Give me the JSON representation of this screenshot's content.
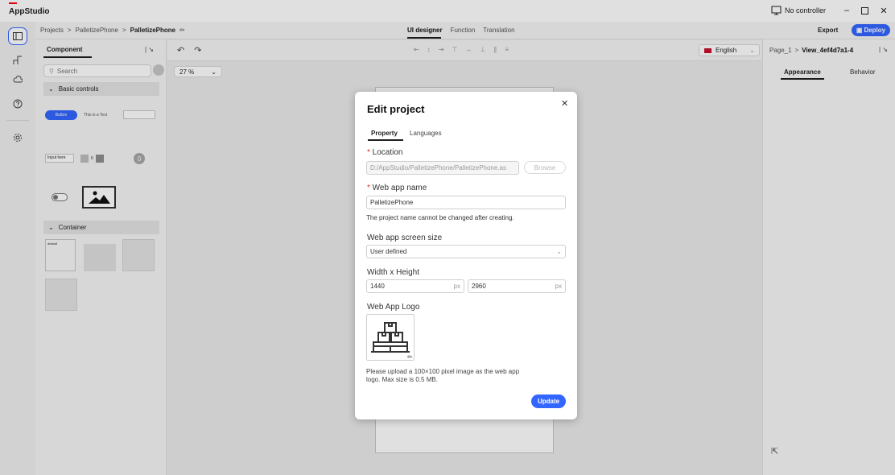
{
  "app": {
    "title": "AppStudio"
  },
  "titlebar": {
    "controller": "No controller"
  },
  "breadcrumb": {
    "root": "Projects",
    "project": "PalletizePhone",
    "current": "PalletizePhone"
  },
  "center_tabs": [
    "UI designer",
    "Function",
    "Translation"
  ],
  "header_actions": {
    "export": "Export",
    "deploy": "Deploy"
  },
  "component_panel": {
    "tab": "Component",
    "search_placeholder": "Search",
    "sections": {
      "basic": "Basic controls",
      "container": "Container"
    },
    "previews": {
      "button": "Button",
      "text": "This is a Text",
      "input": "Input here",
      "stepper_value": "0",
      "badge": "0",
      "container_default": "default"
    }
  },
  "toolbar": {
    "zoom": "27 %",
    "language": "English"
  },
  "right_panel": {
    "page": "Page_1",
    "view": "View_4ef4d7a1-4",
    "tabs": [
      "Appearance",
      "Behavior"
    ]
  },
  "modal": {
    "title": "Edit project",
    "tabs": [
      "Property",
      "Languages"
    ],
    "location_label": "Location",
    "location_value": "D:/AppStudio/PalletizePhone/PalletizePhone.as",
    "browse": "Browse",
    "name_label": "Web app name",
    "name_value": "PalletizePhone",
    "name_hint": "The project name cannot be changed after creating.",
    "size_label": "Web app screen size",
    "size_value": "User defined",
    "wh_label": "Width x Height",
    "width_value": "1440",
    "height_value": "2960",
    "unit": "px",
    "logo_label": "Web App Logo",
    "logo_hint": "Please upload a 100×100 pixel image as the web app logo. Max size is 0.5 MB.",
    "update": "Update"
  },
  "colors": {
    "accent": "#3366ff",
    "brand_red": "#ff000f",
    "required": "#e12e2e"
  }
}
